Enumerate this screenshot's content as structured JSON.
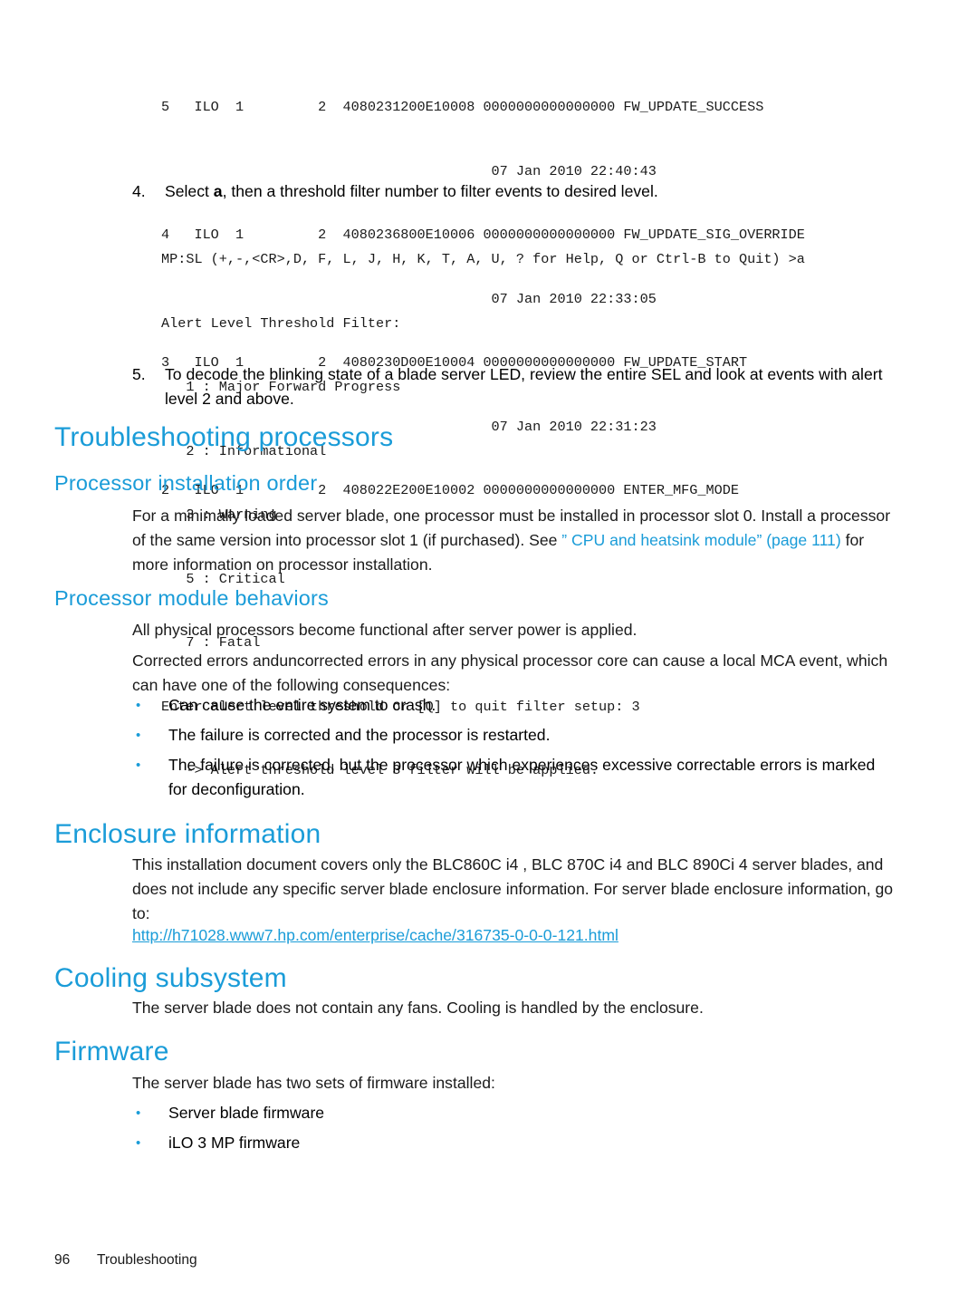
{
  "sel_log": {
    "lines": [
      "5   ILO  1         2  4080231200E10008 0000000000000000 FW_UPDATE_SUCCESS",
      "                                        07 Jan 2010 22:40:43",
      "4   ILO  1         2  4080236800E10006 0000000000000000 FW_UPDATE_SIG_OVERRIDE",
      "                                        07 Jan 2010 22:33:05",
      "3   ILO  1         2  4080230D00E10004 0000000000000000 FW_UPDATE_START",
      "                                        07 Jan 2010 22:31:23",
      "2   ILO  1         2  408022E200E10002 0000000000000000 ENTER_MFG_MODE"
    ]
  },
  "steps": {
    "step4": {
      "number": "4.",
      "text_before": "Select ",
      "bold": "a",
      "text_after": ", then a threshold filter number to filter events to desired level.",
      "console": [
        "MP:SL (+,-,<CR>,D, F, L, J, H, K, T, A, U, ? for Help, Q or Ctrl-B to Quit) >a",
        "Alert Level Threshold Filter:",
        "   1 : Major Forward Progress",
        "   2 : Informational",
        "   3 : Warning",
        "   5 : Critical",
        "   7 : Fatal",
        "Enter alert level threshold or [Q] to quit filter setup: 3",
        "   -> Alert threshold level 3 filter will be applied."
      ]
    },
    "step5": {
      "number": "5.",
      "text": "To decode the blinking state of a blade server LED, review the entire SEL and look at events with alert level 2 and above."
    }
  },
  "sections": {
    "troubleshooting_processors": {
      "heading": "Troubleshooting processors",
      "processor_installation_order": {
        "heading": "Processor installation order",
        "paragraph_part1": "For a minimally loaded server blade, one processor must be installed in processor slot 0. Install a processor of the same version into processor slot 1 (if purchased). See ",
        "link1": "” CPU and heatsink module”",
        "link2": "(page 111)",
        "paragraph_part2": " for more information on processor installation."
      },
      "processor_module_behaviors": {
        "heading": "Processor module behaviors",
        "paragraph1": "All physical processors become functional after server power is applied.",
        "paragraph2": "Corrected errors anduncorrected errors in any physical processor core can cause a local MCA event, which can have one of the following consequences:",
        "bullets": [
          "Can cause the entire system to crash.",
          "The failure is corrected and the processor is restarted.",
          "The failure is corrected, but the processor which experiences excessive correctable errors is marked for deconfiguration."
        ]
      }
    },
    "enclosure_information": {
      "heading": "Enclosure information",
      "paragraph": "This installation document covers only the BLC860C i4 , BLC 870C i4 and BLC 890Ci 4 server blades, and does not include any specific server blade enclosure information. For server blade enclosure information, go to:",
      "url": "http://h71028.www7.hp.com/enterprise/cache/316735-0-0-0-121.html"
    },
    "cooling_subsystem": {
      "heading": "Cooling subsystem",
      "paragraph": "The server blade does not contain any fans. Cooling is handled by the enclosure."
    },
    "firmware": {
      "heading": "Firmware",
      "paragraph": "The server blade has two sets of firmware installed:",
      "bullets": [
        "Server blade firmware",
        "iLO 3 MP firmware"
      ]
    }
  },
  "footer": {
    "page_number": "96",
    "chapter": "Troubleshooting"
  },
  "colors": {
    "heading_blue": "#1a9cd8",
    "link_blue": "#1a9cd8",
    "body_black": "#1a1a1a",
    "page_background": "#ffffff"
  },
  "bullet_glyph": "•"
}
